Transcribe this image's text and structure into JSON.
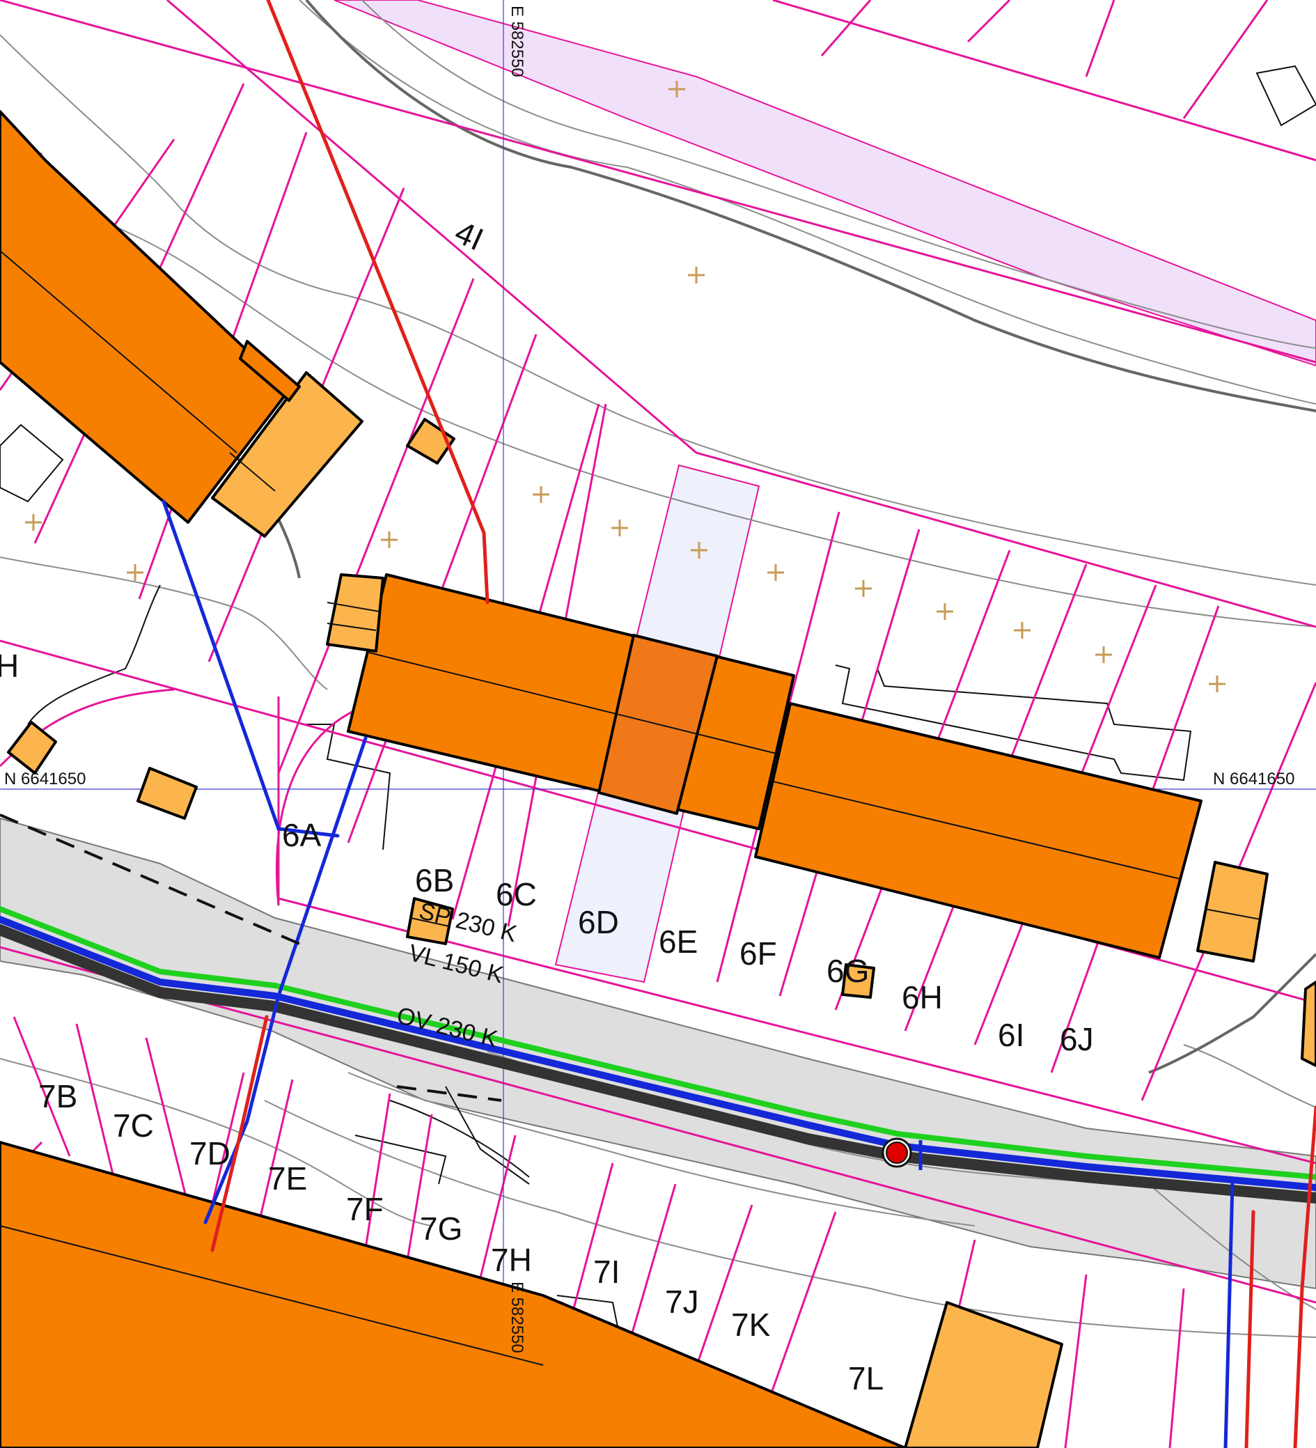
{
  "map": {
    "colors": {
      "background": "#ffffff",
      "property_line": "#e6149a",
      "contour": "#8c8c8c",
      "contour_major": "#666666",
      "building_main": "#f77f00",
      "building_highlight": "#f07818",
      "building_annex": "#fbb54c",
      "building_outline": "#000000",
      "road_fill": "#dedede",
      "easement_band": "#f1e0fa",
      "parcel_highlight": "#eef0fb",
      "water_line": "#1428d8",
      "sewer_line": "#e0201c",
      "green_line": "#1fd01f",
      "dark_line": "#333333",
      "grid_line": "#3c3cd8",
      "survey_cross": "#c89a55",
      "manhole": "#e00000"
    },
    "grid": {
      "easting_top": "E 582550",
      "easting_bottom": "E 582550",
      "northing_left": "N 6641650",
      "northing_right": "N 6641650"
    },
    "parcel_labels": [
      {
        "id": "4I",
        "text": "4I"
      },
      {
        "id": "6A",
        "text": "6A"
      },
      {
        "id": "6B",
        "text": "6B"
      },
      {
        "id": "6C",
        "text": "6C"
      },
      {
        "id": "6D",
        "text": "6D"
      },
      {
        "id": "6E",
        "text": "6E"
      },
      {
        "id": "6F",
        "text": "6F"
      },
      {
        "id": "6G",
        "text": "6G"
      },
      {
        "id": "6H",
        "text": "6H"
      },
      {
        "id": "6I",
        "text": "6I"
      },
      {
        "id": "6J",
        "text": "6J"
      },
      {
        "id": "7B",
        "text": "7B"
      },
      {
        "id": "7C",
        "text": "7C"
      },
      {
        "id": "7D",
        "text": "7D"
      },
      {
        "id": "7E",
        "text": "7E"
      },
      {
        "id": "7F",
        "text": "7F"
      },
      {
        "id": "7G",
        "text": "7G"
      },
      {
        "id": "7H",
        "text": "7H"
      },
      {
        "id": "7I",
        "text": "7I"
      },
      {
        "id": "7J",
        "text": "7J"
      },
      {
        "id": "7K",
        "text": "7K"
      },
      {
        "id": "7L",
        "text": "7L"
      },
      {
        "id": "H",
        "text": "H"
      }
    ],
    "utility_labels": {
      "sp": "SP 230 K",
      "vl": "VL 150 K",
      "ov": "OV 230 K"
    }
  }
}
